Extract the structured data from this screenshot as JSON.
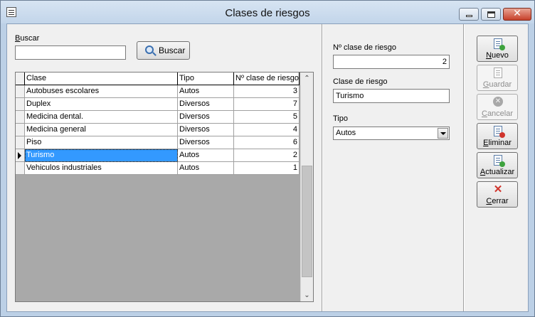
{
  "window": {
    "title": "Clases de riesgos"
  },
  "search": {
    "label_prefix": "B",
    "label_rest": "uscar",
    "value": "",
    "button": "Buscar"
  },
  "grid": {
    "headers": [
      "Clase",
      "Tipo",
      "Nº clase de riesgo"
    ],
    "rows": [
      {
        "clase": "Autobuses escolares",
        "tipo": "Autos",
        "num": "3"
      },
      {
        "clase": "Duplex",
        "tipo": "Diversos",
        "num": "7"
      },
      {
        "clase": "Medicina dental.",
        "tipo": "Diversos",
        "num": "5"
      },
      {
        "clase": "Medicina general",
        "tipo": "Diversos",
        "num": "4"
      },
      {
        "clase": "Piso",
        "tipo": "Diversos",
        "num": "6"
      },
      {
        "clase": "Turismo",
        "tipo": "Autos",
        "num": "2"
      },
      {
        "clase": "Vehiculos industriales",
        "tipo": "Autos",
        "num": "1"
      }
    ],
    "selected_index": 5
  },
  "form": {
    "num_label": "Nº clase de riesgo",
    "num_value": "2",
    "clase_label": "Clase de riesgo",
    "clase_value": "Turismo",
    "tipo_label": "Tipo",
    "tipo_value": "Autos"
  },
  "toolbar": {
    "nuevo_pre": "",
    "nuevo_u": "N",
    "nuevo_rest": "uevo",
    "guardar_pre": "",
    "guardar_u": "G",
    "guardar_rest": "uardar",
    "cancelar_pre": "",
    "cancelar_u": "C",
    "cancelar_rest": "ancelar",
    "eliminar_pre": "",
    "eliminar_u": "E",
    "eliminar_rest": "liminar",
    "actualizar_pre": "",
    "actualizar_u": "A",
    "actualizar_rest": "ctualizar",
    "cerrar_pre": "",
    "cerrar_u": "C",
    "cerrar_rest": "errar"
  },
  "colors": {
    "selection": "#3399ff",
    "title_bg": "#c2d5ea",
    "close_red": "#c7402a"
  }
}
